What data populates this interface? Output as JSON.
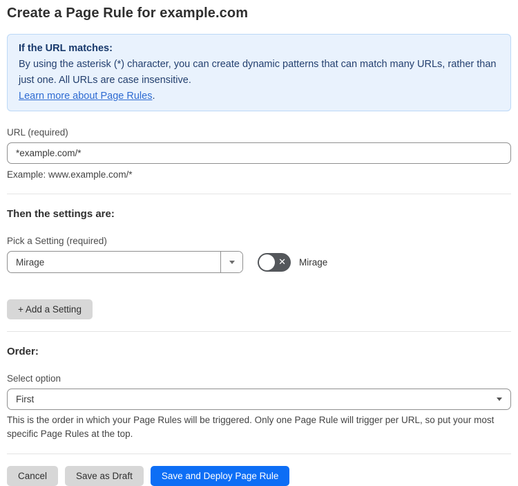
{
  "page": {
    "title": "Create a Page Rule for example.com"
  },
  "info_box": {
    "heading": "If the URL matches:",
    "body": "By using the asterisk (*) character, you can create dynamic patterns that can match many URLs, rather than just one. All URLs are case insensitive.",
    "link_label": "Learn more about Page Rules",
    "link_suffix": "."
  },
  "url_field": {
    "label": "URL (required)",
    "value": "*example.com/*",
    "helper": "Example: www.example.com/*"
  },
  "settings_section": {
    "heading": "Then the settings are:",
    "picker_label": "Pick a Setting (required)",
    "picker_value": "Mirage",
    "toggle_label": "Mirage",
    "toggle_state": "off",
    "add_button_label": "+ Add a Setting"
  },
  "order_section": {
    "heading": "Order:",
    "select_label": "Select option",
    "select_value": "First",
    "helper": "This is the order in which your Page Rules will be triggered. Only one Page Rule will trigger per URL, so put your most specific Page Rules at the top."
  },
  "actions": {
    "cancel_label": "Cancel",
    "save_draft_label": "Save as Draft",
    "save_deploy_label": "Save and Deploy Page Rule"
  },
  "icons": {
    "toggle_x": "✕"
  },
  "colors": {
    "info_bg": "#e9f2fd",
    "info_border": "#bcd8f7",
    "info_text": "#24406f",
    "link": "#2e6bd2",
    "primary_button": "#0d6ef5",
    "gray_button": "#d7d7d7",
    "toggle_off": "#54575b",
    "input_border": "#8f8f8f",
    "divider": "#e4e4e4"
  }
}
